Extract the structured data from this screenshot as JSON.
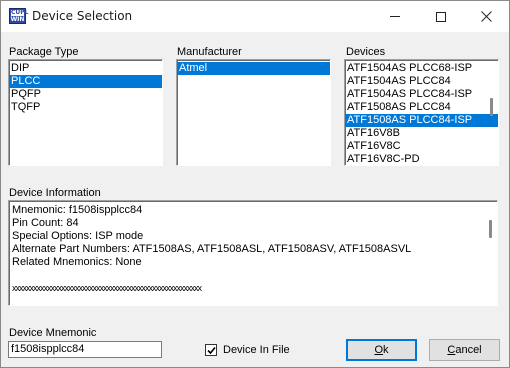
{
  "window": {
    "title": "Device Selection",
    "icon_text_top": "CUPL",
    "icon_text_bottom": "WIN"
  },
  "package_type": {
    "label": "Package Type",
    "items": [
      "DIP",
      "PLCC",
      "PQFP",
      "TQFP"
    ],
    "selected": "PLCC"
  },
  "manufacturer": {
    "label": "Manufacturer",
    "items": [
      "Atmel"
    ],
    "selected": "Atmel"
  },
  "devices": {
    "label": "Devices",
    "items": [
      "ATF1504AS PLCC68-ISP",
      "ATF1504AS PLCC84",
      "ATF1504AS PLCC84-ISP",
      "ATF1508AS PLCC84",
      "ATF1508AS PLCC84-ISP",
      "ATF16V8B",
      "ATF16V8C",
      "ATF16V8C-PD"
    ],
    "selected": "ATF1508AS PLCC84-ISP"
  },
  "device_information": {
    "label": "Device Information",
    "lines": [
      "Mnemonic:  f1508ispplcc84",
      "Pin Count:  84",
      "Special Options:  ISP mode",
      "Alternate Part Numbers:  ATF1508AS, ATF1508ASL, ATF1508ASV, ATF1508ASVL",
      "Related Mnemonics:  None",
      "",
      "xxxxxxxxxxxxxxxxxxxxxxxxxxxxxxxxxxxxxxxxxxxxxxxxxxxxxx"
    ]
  },
  "device_mnemonic": {
    "label": "Device Mnemonic",
    "value": "f1508ispplcc84"
  },
  "device_in_file": {
    "label": "Device In File",
    "checked": true
  },
  "buttons": {
    "ok_accel": "O",
    "ok_rest": "k",
    "cancel_accel": "C",
    "cancel_rest": "ancel"
  },
  "colors": {
    "selection": "#0078d7",
    "dialog_bg": "#f0f0f0",
    "default_button_border": "#0078d7"
  },
  "icons": [
    "app-icon",
    "minimize-icon",
    "maximize-icon",
    "close-icon",
    "checkmark-icon"
  ]
}
